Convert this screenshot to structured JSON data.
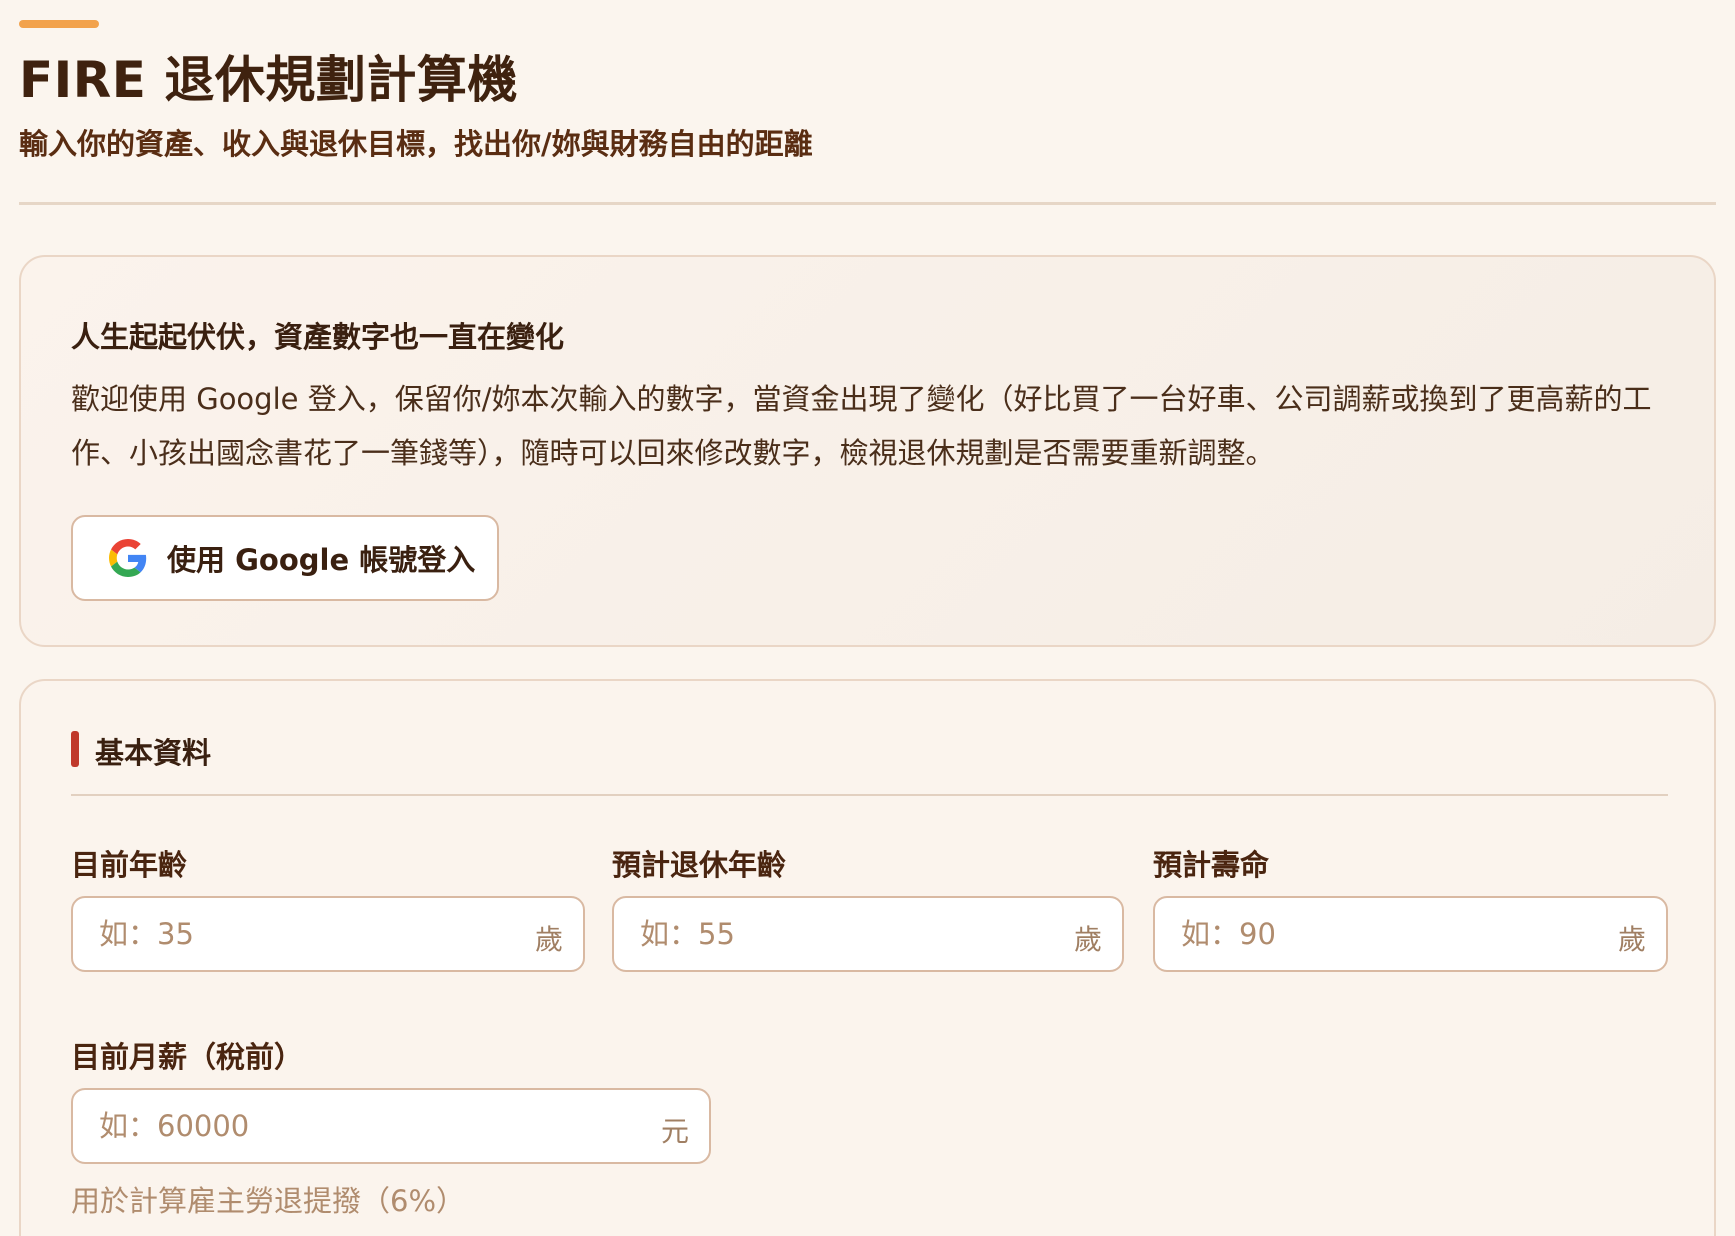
{
  "header": {
    "title": "FIRE 退休規劃計算機",
    "subtitle": "輸入你的資產、收入與退休目標，找出你/妳與財務自由的距離"
  },
  "login_card": {
    "heading": "人生起起伏伏，資產數字也一直在變化",
    "description": "歡迎使用 Google 登入，保留你/妳本次輸入的數字，當資金出現了變化（好比買了一台好車、公司調薪或換到了更高薪的工作、小孩出國念書花了一筆錢等），隨時可以回來修改數字，檢視退休規劃是否需要重新調整。",
    "google_button_label": "使用 Google 帳號登入",
    "google_icon": "google-logo-icon"
  },
  "basic_info": {
    "section_title": "基本資料",
    "accent_color": "#c0392b",
    "fields": {
      "current_age": {
        "label": "目前年齡",
        "placeholder": "如：35",
        "value": "",
        "unit": "歲"
      },
      "retire_age": {
        "label": "預計退休年齡",
        "placeholder": "如：55",
        "value": "",
        "unit": "歲"
      },
      "life_expectancy": {
        "label": "預計壽命",
        "placeholder": "如：90",
        "value": "",
        "unit": "歲"
      },
      "monthly_salary": {
        "label": "目前月薪（稅前）",
        "placeholder": "如：60000",
        "value": "",
        "unit": "元",
        "hint": "用於計算雇主勞退提撥（6%）"
      }
    }
  },
  "colors": {
    "page_background": "#fbf5ee",
    "accent_orange": "#f2a24c",
    "title_brown": "#3f220f"
  }
}
